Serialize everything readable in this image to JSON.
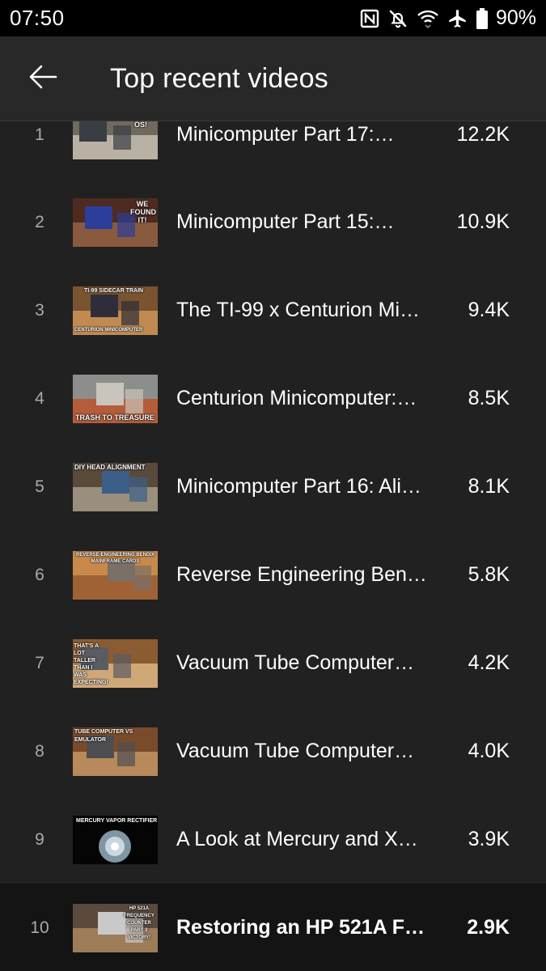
{
  "status": {
    "time": "07:50",
    "battery": "90%",
    "icons": [
      "nfc-icon",
      "bell-off-icon",
      "wifi-icon",
      "airplane-icon",
      "battery-icon"
    ]
  },
  "header": {
    "title": "Top recent videos",
    "back_icon": "arrow-left-icon"
  },
  "colors": {
    "background": "#212121",
    "app_bar": "#282828",
    "status_bar": "#000000",
    "highlight_row": "#141414",
    "rank_text": "#aaaaaa"
  },
  "videos": [
    {
      "rank": "1",
      "title": "Minicomputer Part 17:…",
      "views": "12.2K",
      "thumb_caption": "IS THE OS!"
    },
    {
      "rank": "2",
      "title": "Minicomputer Part 15:…",
      "views": "10.9K",
      "thumb_caption": "WE FOUND IT!"
    },
    {
      "rank": "3",
      "title": "The TI-99 x Centurion Mi…",
      "views": "9.4K",
      "thumb_caption": "TI-99 SIDECAR TRAIN",
      "thumb_caption2": "CENTURION MINICOMPUTER"
    },
    {
      "rank": "4",
      "title": "Centurion Minicomputer:…",
      "views": "8.5K",
      "thumb_caption": "TRASH TO TREASURE"
    },
    {
      "rank": "5",
      "title": "Minicomputer Part 16: Ali…",
      "views": "8.1K",
      "thumb_caption": "DIY HEAD ALIGNMENT"
    },
    {
      "rank": "6",
      "title": "Reverse Engineering Ben…",
      "views": "5.8K",
      "thumb_caption": "REVERSE-ENGINEERING BENDIX MAINFRAME CARDS"
    },
    {
      "rank": "7",
      "title": "Vacuum Tube Computer…",
      "views": "4.2K",
      "thumb_caption": "THAT'S A LOT TALLER THAN I WAS EXPECTING!"
    },
    {
      "rank": "8",
      "title": "Vacuum Tube Computer…",
      "views": "4.0K",
      "thumb_caption": "TUBE COMPUTER VS EMULATOR"
    },
    {
      "rank": "9",
      "title": "A Look at Mercury and X…",
      "views": "3.9K",
      "thumb_caption": "MERCURY VAPOR RECTIFIER"
    },
    {
      "rank": "10",
      "title": "Restoring an HP 521A Fr…",
      "views": "2.9K",
      "thumb_caption": "HP 521A FREQUENCY COUNTER PART 3 VICTORY!"
    }
  ]
}
